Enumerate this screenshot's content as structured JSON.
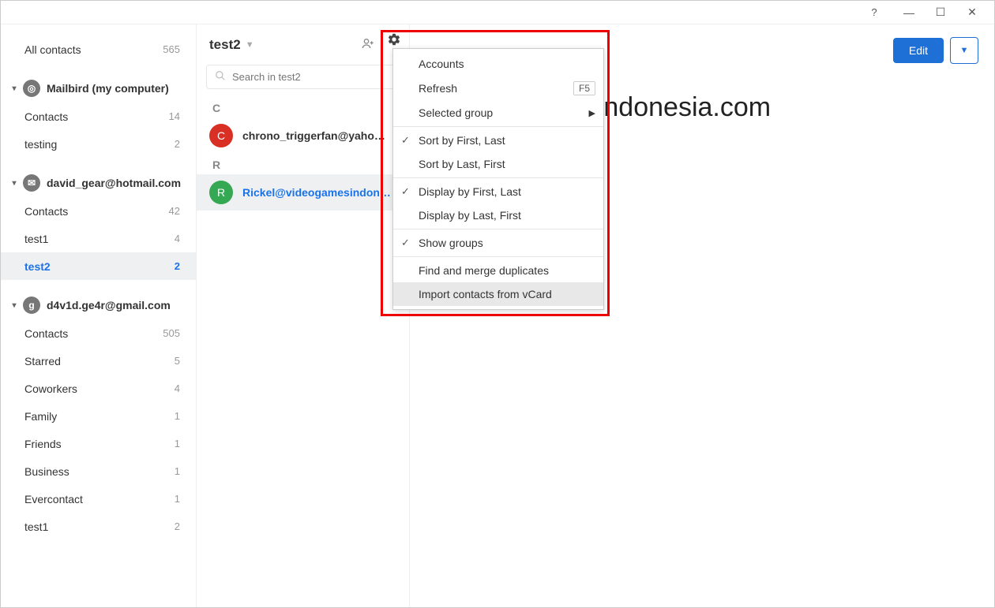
{
  "titlebar": {
    "help": "?",
    "minimize": "—",
    "maximize": "☐",
    "close": "✕"
  },
  "sidebar": {
    "all_label": "All contacts",
    "all_count": "565",
    "accounts": [
      {
        "name": "Mailbird (my computer)",
        "icon": "◎",
        "items": [
          {
            "label": "Contacts",
            "count": "14"
          },
          {
            "label": "testing",
            "count": "2"
          }
        ]
      },
      {
        "name": "david_gear@hotmail.com",
        "icon": "✉",
        "items": [
          {
            "label": "Contacts",
            "count": "42"
          },
          {
            "label": "test1",
            "count": "4"
          },
          {
            "label": "test2",
            "count": "2",
            "active": true
          }
        ]
      },
      {
        "name": "d4v1d.ge4r@gmail.com",
        "icon": "g",
        "items": [
          {
            "label": "Contacts",
            "count": "505"
          },
          {
            "label": "Starred",
            "count": "5"
          },
          {
            "label": "Coworkers",
            "count": "4"
          },
          {
            "label": "Family",
            "count": "1"
          },
          {
            "label": "Friends",
            "count": "1"
          },
          {
            "label": "Business",
            "count": "1"
          },
          {
            "label": "Evercontact",
            "count": "1"
          },
          {
            "label": "test1",
            "count": "2"
          }
        ]
      }
    ]
  },
  "middle": {
    "title": "test2",
    "search_placeholder": "Search in test2",
    "sections": [
      {
        "letter": "C",
        "contacts": [
          {
            "initial": "C",
            "name": "chrono_triggerfan@yaho…",
            "color": "red"
          }
        ]
      },
      {
        "letter": "R",
        "contacts": [
          {
            "initial": "R",
            "name": "Rickel@videogamesindon…",
            "color": "green",
            "selected": true
          }
        ]
      }
    ]
  },
  "menu": {
    "items": [
      {
        "label": "Accounts"
      },
      {
        "label": "Refresh",
        "shortcut": "F5"
      },
      {
        "label": "Selected group",
        "submenu": true
      },
      {
        "sep": true
      },
      {
        "label": "Sort by First, Last",
        "checked": true
      },
      {
        "label": "Sort by Last, First"
      },
      {
        "sep": true
      },
      {
        "label": "Display by First, Last",
        "checked": true
      },
      {
        "label": "Display by Last, First"
      },
      {
        "sep": true
      },
      {
        "label": "Show groups",
        "checked": true
      },
      {
        "sep": true
      },
      {
        "label": "Find and merge duplicates"
      },
      {
        "label": "Import contacts from vCard",
        "hover": true
      }
    ]
  },
  "detail": {
    "edit": "Edit",
    "title_suffix": "@videogamesindonesia.com",
    "email_partial": "ia.com"
  }
}
